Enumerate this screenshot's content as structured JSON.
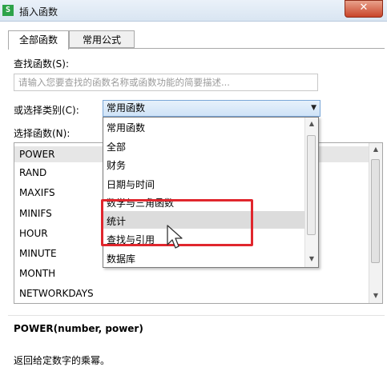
{
  "window": {
    "title": "插入函数",
    "app_icon": "S",
    "close_label": "✕"
  },
  "tabs": [
    {
      "label": "全部函数",
      "active": true
    },
    {
      "label": "常用公式",
      "active": false
    }
  ],
  "search": {
    "label": "查找函数(S):",
    "placeholder": "请输入您要查找的函数名称或函数功能的简要描述..."
  },
  "category": {
    "label": "或选择类别(C):",
    "selected": "常用函数",
    "options": [
      "常用函数",
      "全部",
      "财务",
      "日期与时间",
      "数学与三角函数",
      "统计",
      "查找与引用",
      "数据库"
    ],
    "hovered_index": 5
  },
  "functions": {
    "label": "选择函数(N):",
    "items": [
      "POWER",
      "RAND",
      "MAXIFS",
      "MINIFS",
      "HOUR",
      "MINUTE",
      "MONTH",
      "NETWORKDAYS"
    ],
    "selected_index": 0
  },
  "details": {
    "signature": "POWER(number, power)",
    "description": "返回给定数字的乘幂。"
  },
  "colors": {
    "highlight_box": "#e0262d",
    "combo_border": "#7aa7d8",
    "close_button": "#c9452a"
  }
}
